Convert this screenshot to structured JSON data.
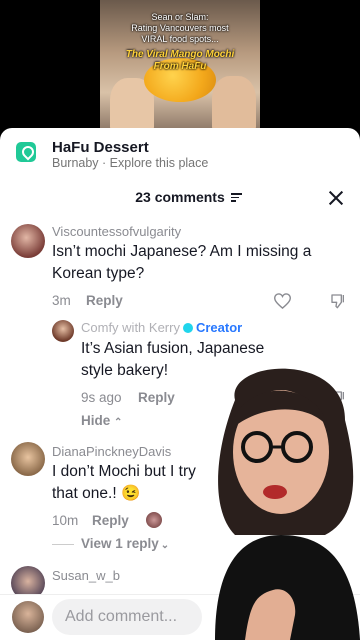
{
  "video": {
    "overlay_lines": [
      "Sean or Slam:",
      "Rating Vancouvers most",
      "VIRAL food spots..."
    ],
    "highlight_lines": [
      "The Viral Mango Mochi",
      "From HaFu"
    ]
  },
  "place": {
    "title": "HaFu Dessert",
    "subtitle": "Burnaby · Explore this place"
  },
  "comments_header": {
    "count_label": "23 comments"
  },
  "comments": [
    {
      "username": "Viscountessofvulgarity",
      "text": "Isn’t mochi Japanese? Am I missing a Korean type?",
      "time": "3m",
      "reply_label": "Reply"
    },
    {
      "username": "Comfy with Kerry",
      "creator_label": "Creator",
      "text": "It’s Asian fusion, Japanese style bakery!",
      "time": "9s ago",
      "reply_label": "Reply",
      "hide_label": "Hide"
    },
    {
      "username": "DianaPinckneyDavis",
      "text": "I don’t Mochi but I try that one.! 😉",
      "time": "10m",
      "reply_label": "Reply",
      "view_replies_label": "View 1 reply"
    },
    {
      "username": "Susan_w_b"
    }
  ],
  "input": {
    "placeholder": "Add comment..."
  },
  "colors": {
    "accent_creator": "#2878ff",
    "place_icon": "#20c997",
    "text_primary": "#161823",
    "text_secondary": "#8a8b91"
  }
}
